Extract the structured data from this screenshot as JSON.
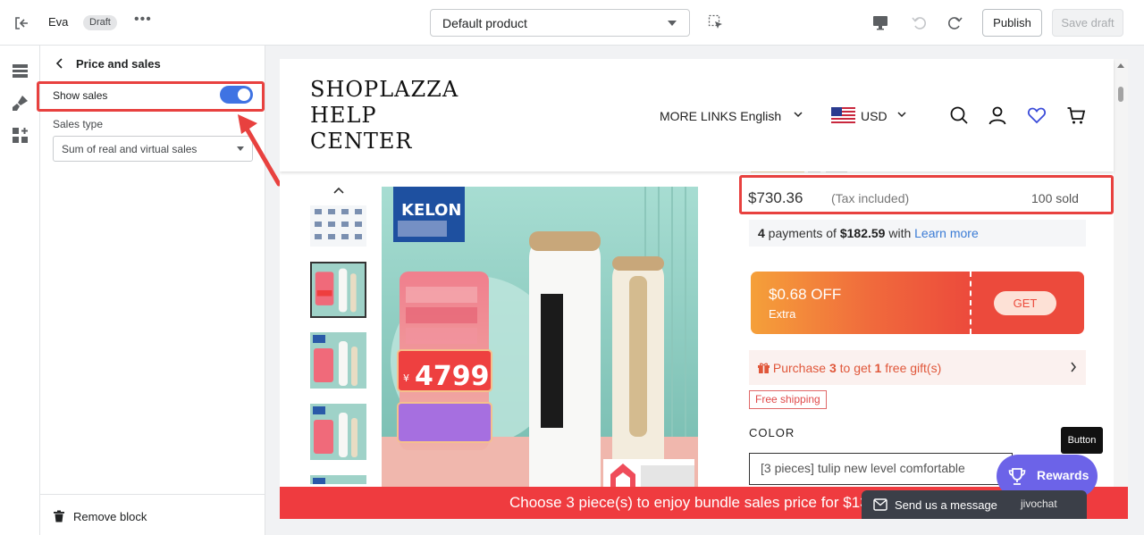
{
  "topbar": {
    "exit_icon": "exit-icon",
    "theme_name": "Eva",
    "status_badge": "Draft",
    "more_icon": "more-horizontal-icon",
    "template_select": "Default product",
    "inspect_icon": "select-element-icon",
    "device_icon": "desktop-preview-icon",
    "undo_icon": "undo-icon",
    "redo_icon": "redo-icon",
    "publish_label": "Publish",
    "save_label": "Save draft"
  },
  "rail": {
    "items": [
      {
        "icon": "sections-icon"
      },
      {
        "icon": "theme-settings-brush-icon"
      },
      {
        "icon": "apps-icon"
      }
    ]
  },
  "panel": {
    "title": "Price and sales",
    "show_sales_label": "Show sales",
    "show_sales_enabled": true,
    "sales_type_label": "Sales type",
    "sales_type_value": "Sum of real and virtual sales",
    "remove_block_label": "Remove block"
  },
  "preview": {
    "logo_lines": [
      "SHOPLAZZA",
      "HELP",
      "CENTER"
    ],
    "more_links": "MORE LINKS",
    "language": "English",
    "currency": "USD",
    "price": "$730.36",
    "tax_note": "(Tax included)",
    "sold": "100 sold",
    "payments": {
      "count": "4",
      "prefix": " payments of ",
      "amount": "$182.59",
      "middle": " with ",
      "link": "Learn more"
    },
    "coupon": {
      "amount": "$0.68 OFF",
      "subtitle": "Extra",
      "button": "GET"
    },
    "gift": {
      "p1": "Purchase ",
      "qty": "3",
      "p2": " to get ",
      "free_qty": "1",
      "p3": " free gift(s)"
    },
    "free_shipping": "Free shipping",
    "color_label": "COLOR",
    "variant_value": "[3 pieces] tulip new level comfortable",
    "tooltip": "Button",
    "rewards_label": "Rewards",
    "bundle_bar": "Choose 3 piece(s) to enjoy bundle sales price for $13",
    "chat_label": "Send us a message",
    "chat_brand": "jivochat",
    "image": {
      "brand_badge": "KELON",
      "promo_price": "4799"
    }
  },
  "colors": {
    "accent_blue": "#3f73e3",
    "highlight_red": "#e8413f",
    "bundle_red": "#ef3b3f",
    "rewards_purple": "#6c63e8"
  }
}
